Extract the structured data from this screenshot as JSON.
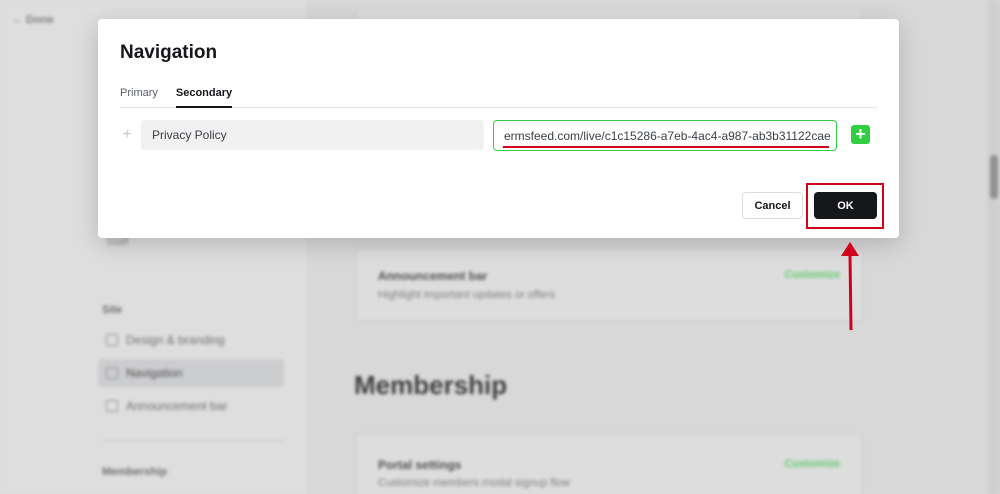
{
  "background": {
    "done_label": "← Done",
    "sidebar": {
      "staff_label": "Staff",
      "site_heading": "Site",
      "items": [
        {
          "label": "Design & branding",
          "icon": "brush-icon"
        },
        {
          "label": "Navigation",
          "icon": "navigation-icon",
          "active": true
        },
        {
          "label": "Announcement bar",
          "icon": "megaphone-icon"
        }
      ],
      "membership_heading": "Membership"
    },
    "announcement_card": {
      "title": "Announcement bar",
      "description": "Highlight important updates or offers",
      "action": "Customize"
    },
    "membership_section_title": "Membership",
    "portal_card": {
      "title": "Portal settings",
      "description": "Customize members modal signup flow",
      "action": "Customize"
    }
  },
  "modal": {
    "title": "Navigation",
    "tabs": [
      {
        "label": "Primary",
        "active": false
      },
      {
        "label": "Secondary",
        "active": true
      }
    ],
    "item": {
      "label_value": "Privacy Policy",
      "url_value": "ermsfeed.com/live/c1c15286-a7eb-4ac4-a987-ab3b31122cae"
    },
    "cancel_label": "Cancel",
    "ok_label": "OK"
  },
  "colors": {
    "accent_green": "#30cf43",
    "annotation_red": "#d0021b",
    "primary_dark": "#15171a"
  }
}
